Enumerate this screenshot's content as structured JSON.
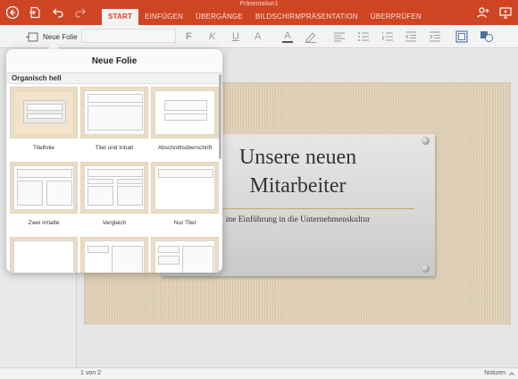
{
  "app": {
    "document_title": "Präsentation1",
    "tabs": [
      {
        "label": "START",
        "active": true
      },
      {
        "label": "EINFÜGEN",
        "active": false
      },
      {
        "label": "ÜBERGÄNGE",
        "active": false
      },
      {
        "label": "BILDSCHIRMPRÄSENTATION",
        "active": false
      },
      {
        "label": "ÜBERPRÜFEN",
        "active": false
      }
    ],
    "accent_color": "#cf4524"
  },
  "toolbar": {
    "new_slide_label": "Neue Folie",
    "bold_label": "F",
    "italic_label": "K",
    "underline_label": "U",
    "font_size_label": "A",
    "font_color_label": "A"
  },
  "popover": {
    "title": "Neue Folie",
    "section": "Organisch hell",
    "layouts": [
      {
        "label": "Titelfolie"
      },
      {
        "label": "Titel und Inhalt"
      },
      {
        "label": "Abschnittsüberschrift"
      },
      {
        "label": "Zwei Inhalte"
      },
      {
        "label": "Vergleich"
      },
      {
        "label": "Nur Titel"
      },
      {
        "label": ""
      },
      {
        "label": ""
      },
      {
        "label": ""
      }
    ]
  },
  "slide": {
    "title_line1": "Unsere neuen",
    "title_line2": "Mitarbeiter",
    "subtitle": "ine Einführung in die Unternehmenskultur"
  },
  "status": {
    "slide_counter": "1 von 2",
    "notes_label": "Notizen"
  }
}
